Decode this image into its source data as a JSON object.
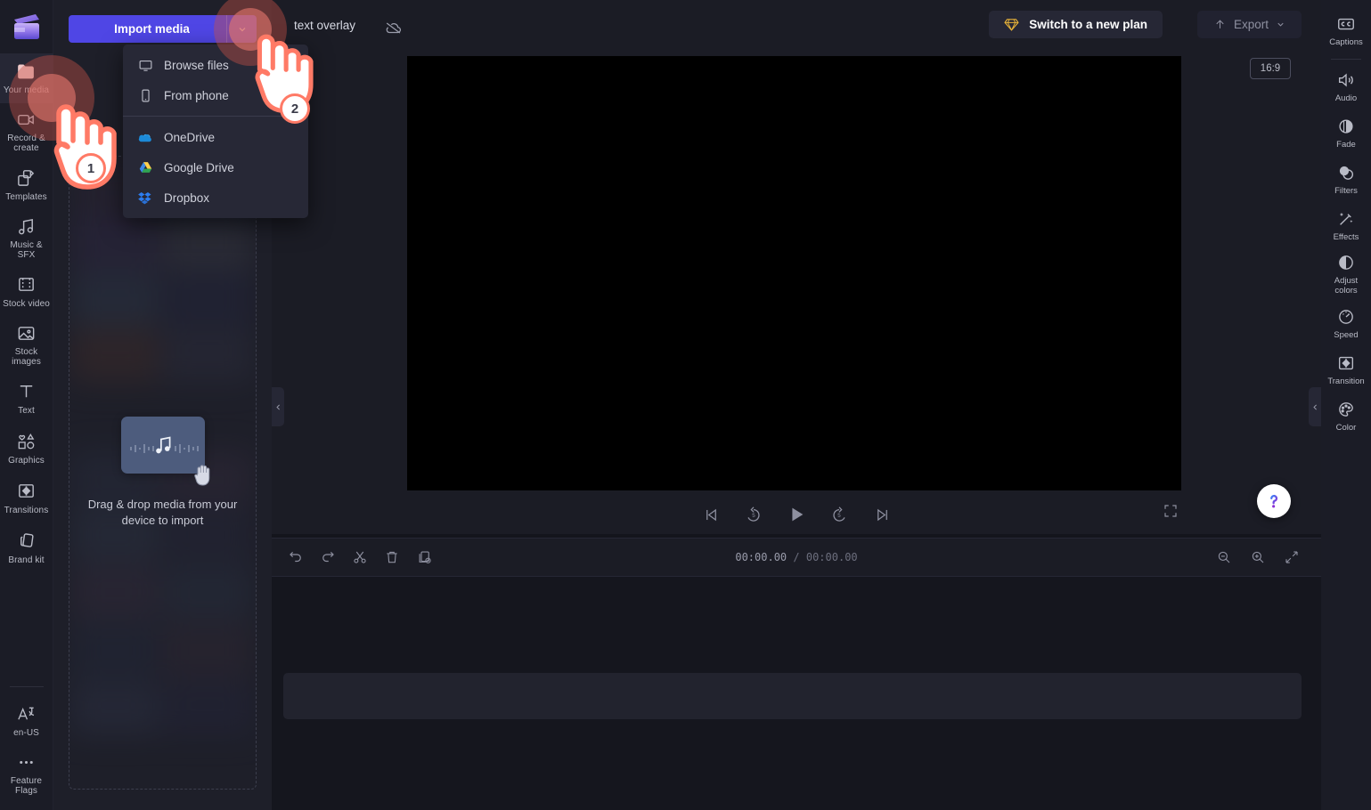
{
  "app": {
    "logo_icon": "clipchamp-clapperboard-logo",
    "project_title": "text overlay",
    "offline_icon": "cloud-offline-icon"
  },
  "left_rail": {
    "items": [
      {
        "label": "Your media",
        "icon": "folder-media-icon",
        "active": true
      },
      {
        "label": "Record &\ncreate",
        "icon": "video-camera-icon",
        "active": false
      },
      {
        "label": "Templates",
        "icon": "templates-grid-icon",
        "active": false
      },
      {
        "label": "Music & SFX",
        "icon": "music-note-icon",
        "active": false
      },
      {
        "label": "Stock video",
        "icon": "film-strip-icon",
        "active": false
      },
      {
        "label": "Stock\nimages",
        "icon": "image-photo-icon",
        "active": false
      },
      {
        "label": "Text",
        "icon": "text-t-icon",
        "active": false
      },
      {
        "label": "Graphics",
        "icon": "shapes-graphics-icon",
        "active": false
      },
      {
        "label": "Transitions",
        "icon": "transition-icon",
        "active": false
      },
      {
        "label": "Brand kit",
        "icon": "brand-kit-cards-icon",
        "active": false
      }
    ],
    "bottom_items": [
      {
        "label": "en-US",
        "icon": "language-icon"
      },
      {
        "label": "Feature\nFlags",
        "icon": "ellipsis-icon"
      }
    ]
  },
  "media_panel": {
    "import_button": {
      "label": "Import media",
      "caret_icon": "chevron-down-icon"
    },
    "dropdown": {
      "group_local": [
        {
          "label": "Browse files",
          "icon": "monitor-icon"
        },
        {
          "label": "From phone",
          "icon": "phone-icon"
        }
      ],
      "group_cloud": [
        {
          "label": "OneDrive",
          "icon": "onedrive-cloud-icon"
        },
        {
          "label": "Google Drive",
          "icon": "google-drive-icon"
        },
        {
          "label": "Dropbox",
          "icon": "dropbox-icon"
        }
      ]
    },
    "dropzone": {
      "text": "Drag & drop media from your device to import",
      "card_icon": "music-note-icon",
      "cursor_icon": "grab-hand-icon"
    }
  },
  "topbar": {
    "upgrade_button": {
      "label": "Switch to a new plan",
      "icon": "diamond-icon"
    },
    "export_button": {
      "label": "Export",
      "icon": "upload-arrow-icon",
      "caret_icon": "chevron-down-icon"
    }
  },
  "preview": {
    "aspect_ratio": "16:9",
    "collapse_left_icon": "chevron-left-icon",
    "collapse_right_icon": "chevron-left-icon",
    "help_icon": "question-mark-icon",
    "controls": [
      {
        "name": "skip-to-start-button",
        "icon": "skip-back-icon"
      },
      {
        "name": "rewind-5-button",
        "icon": "rewind-5-icon"
      },
      {
        "name": "play-button",
        "icon": "play-icon"
      },
      {
        "name": "forward-5-button",
        "icon": "forward-5-icon"
      },
      {
        "name": "skip-to-end-button",
        "icon": "skip-forward-icon"
      }
    ],
    "fullscreen_icon": "fullscreen-icon"
  },
  "timeline": {
    "tools": [
      {
        "name": "undo-button",
        "icon": "undo-icon"
      },
      {
        "name": "redo-button",
        "icon": "redo-icon"
      },
      {
        "name": "split-button",
        "icon": "scissors-icon"
      },
      {
        "name": "delete-button",
        "icon": "trash-icon"
      },
      {
        "name": "duplicate-button",
        "icon": "duplicate-icon"
      }
    ],
    "current_time": "00:00.00",
    "separator": " / ",
    "total_time": "00:00.00",
    "zoom_tools": [
      {
        "name": "zoom-out-button",
        "icon": "magnifier-minus-icon"
      },
      {
        "name": "zoom-in-button",
        "icon": "magnifier-plus-icon"
      },
      {
        "name": "fit-timeline-button",
        "icon": "fit-arrows-icon"
      }
    ]
  },
  "right_rail": {
    "items": [
      {
        "label": "Captions",
        "icon": "closed-captions-icon",
        "divider_after": true
      },
      {
        "label": "Audio",
        "icon": "speaker-icon",
        "divider_after": false
      },
      {
        "label": "Fade",
        "icon": "fade-circle-icon",
        "divider_after": false
      },
      {
        "label": "Filters",
        "icon": "filters-overlap-icon",
        "divider_after": false
      },
      {
        "label": "Effects",
        "icon": "magic-wand-icon",
        "divider_after": false
      },
      {
        "label": "Adjust\ncolors",
        "icon": "contrast-circle-icon",
        "divider_after": false
      },
      {
        "label": "Speed",
        "icon": "speedometer-icon",
        "divider_after": false
      },
      {
        "label": "Transition",
        "icon": "transition-icon",
        "divider_after": false
      },
      {
        "label": "Color",
        "icon": "palette-icon",
        "divider_after": false
      }
    ]
  },
  "annotations": {
    "steps": [
      {
        "number": "1",
        "target": "sidebar-item-your-media",
        "cursor_icon": "pointing-hand-icon"
      },
      {
        "number": "2",
        "target": "import-media-dropdown-caret",
        "cursor_icon": "pointing-hand-icon"
      }
    ]
  },
  "colors": {
    "accent_primary": "#4f46e5",
    "panel_bg": "#1e1f29",
    "rail_bg": "#1b1c26",
    "app_bg": "#14151c",
    "annotation": "#ff7a66",
    "upgrade_gold": "#e8b339",
    "text_primary": "#cfd1db",
    "text_muted": "#9a9cab"
  }
}
